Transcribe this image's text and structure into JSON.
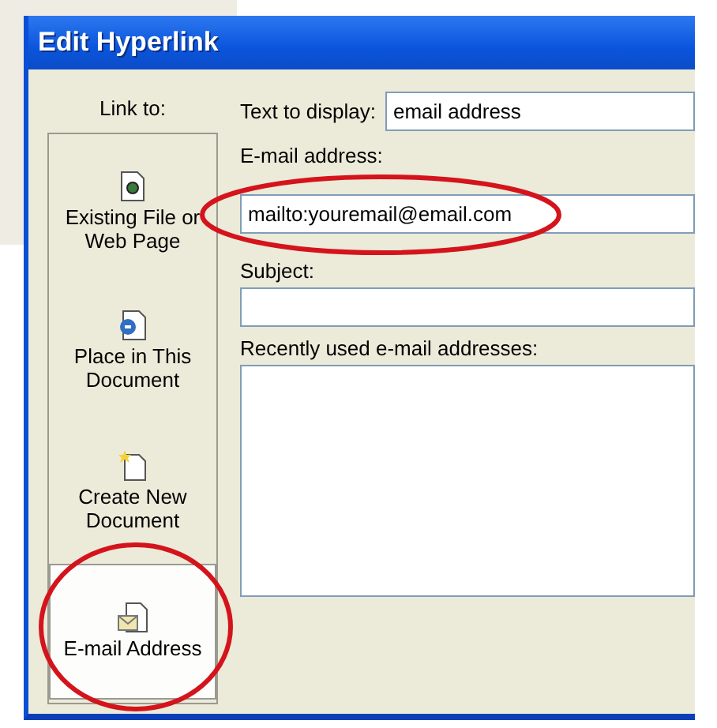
{
  "window": {
    "title": "Edit Hyperlink"
  },
  "link_to": {
    "label": "Link to:",
    "items": [
      {
        "label": "Existing File or Web Page",
        "kind": "file",
        "selected": false,
        "circled": false
      },
      {
        "label": "Place in This Document",
        "kind": "place",
        "selected": false,
        "circled": false
      },
      {
        "label": "Create New Document",
        "kind": "new",
        "selected": false,
        "circled": false
      },
      {
        "label": "E-mail Address",
        "kind": "email",
        "selected": true,
        "circled": true
      }
    ]
  },
  "fields": [
    {
      "kind": "inline",
      "label": "Text to display:",
      "value": "email address",
      "circled": false
    },
    {
      "kind": "text",
      "label": "E-mail address:",
      "value": "mailto:youremail@email.com",
      "circled": true
    },
    {
      "kind": "text",
      "label": "Subject:",
      "circled": false
    },
    {
      "kind": "list",
      "label": "Recently used e-mail addresses:",
      "circled": false
    }
  ]
}
